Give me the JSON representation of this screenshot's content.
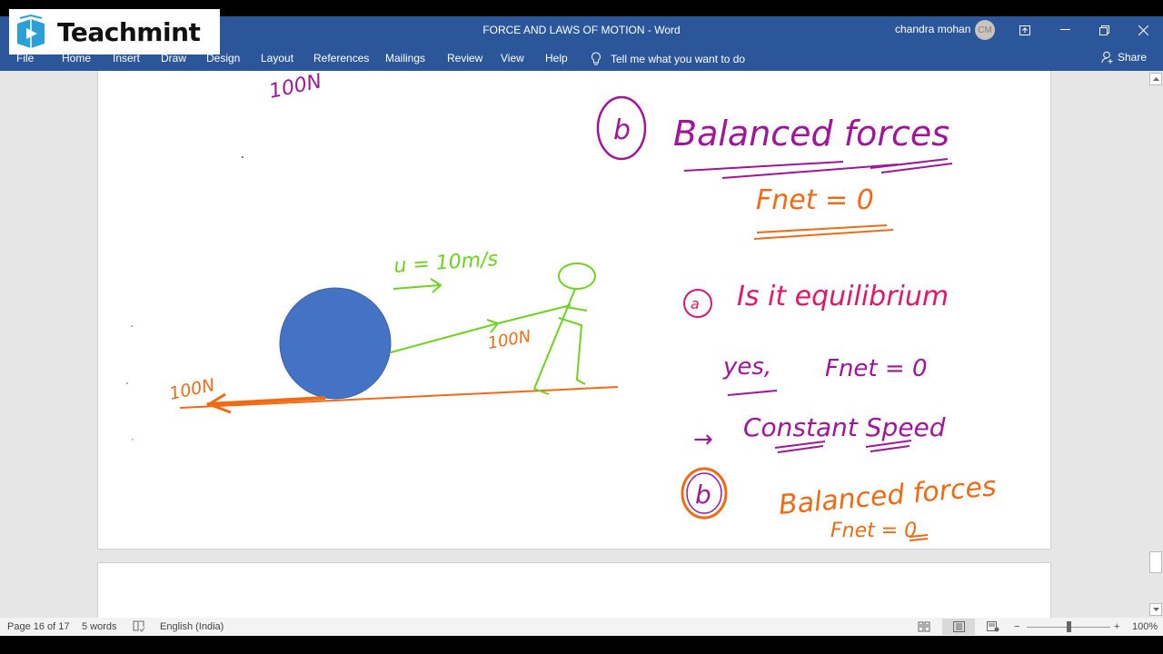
{
  "window": {
    "title": "FORCE AND LAWS OF MOTION  -  Word",
    "user_name": "chandra mohan",
    "user_initials": "CM",
    "controls": {
      "ribbon_display": "⊡",
      "minimize": "—",
      "restore": "❐",
      "close": "✕"
    }
  },
  "watermark": {
    "brand": "Teachmint",
    "icon": "teachmint-logo-icon"
  },
  "ribbon": {
    "tabs": [
      {
        "label": "File"
      },
      {
        "label": "Home"
      },
      {
        "label": "Insert"
      },
      {
        "label": "Draw"
      },
      {
        "label": "Design"
      },
      {
        "label": "Layout"
      },
      {
        "label": "References"
      },
      {
        "label": "Mailings"
      },
      {
        "label": "Review"
      },
      {
        "label": "View"
      },
      {
        "label": "Help"
      }
    ],
    "tell_me": "Tell me what you want to do",
    "share": "Share"
  },
  "document": {
    "ink_text": {
      "top_force": "100N",
      "velocity": "u = 10m/s",
      "pull_force": "100N",
      "friction_force": "100N",
      "heading_marker": "b",
      "heading": "Balanced forces",
      "heading_formula": "Fnet = 0",
      "question_marker": "a",
      "question": "Is it equilibrium",
      "answer": "yes,",
      "answer_formula": "Fnet = 0",
      "consequence_arrow": "→",
      "consequence": "Constant Speed",
      "second_marker": "b",
      "second_heading": "Balanced forces",
      "second_formula": "Fnet = 0"
    },
    "ink_colors": {
      "purple": "#a0159a",
      "orange": "#f06a14",
      "green": "#6fd21f",
      "pink": "#e0186a",
      "ball": "#4472c4"
    }
  },
  "status_bar": {
    "page": "Page 16 of 17",
    "words": "5 words",
    "language": "English (India)",
    "zoom": "100%",
    "zoom_minus": "−",
    "zoom_plus": "+"
  }
}
